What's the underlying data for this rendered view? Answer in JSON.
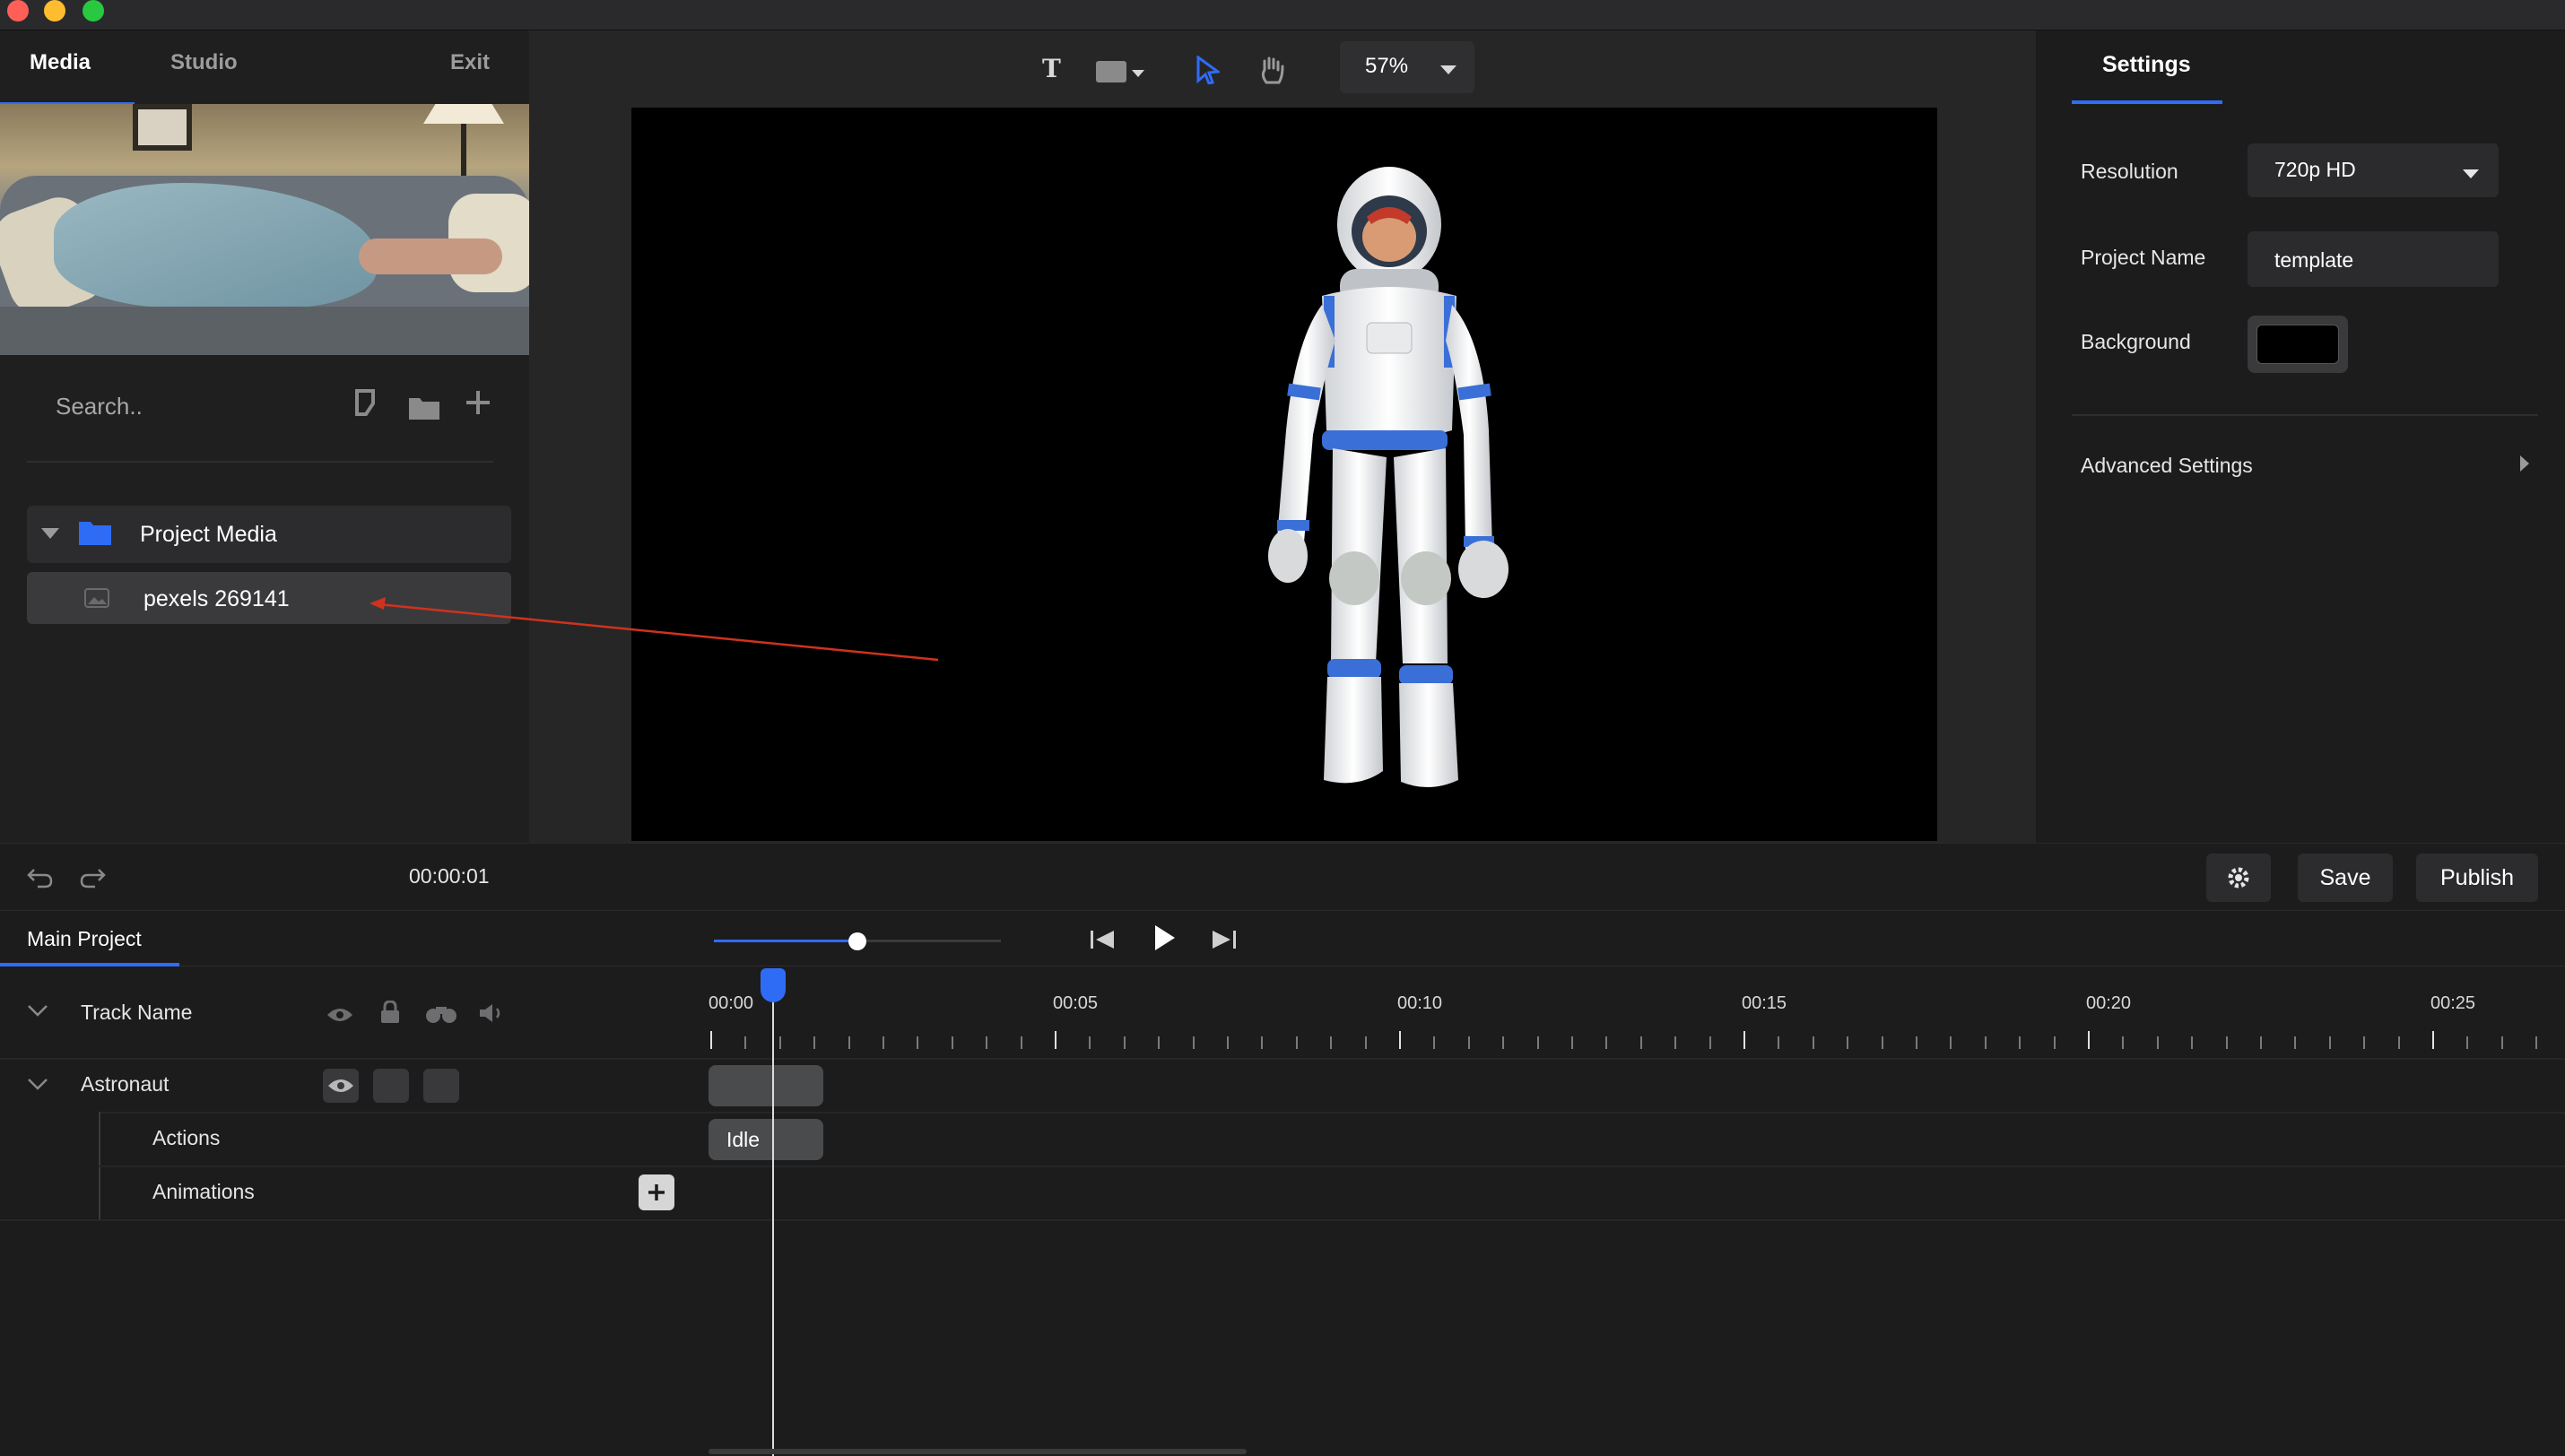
{
  "top_tabs": {
    "media": "Media",
    "studio": "Studio",
    "exit": "Exit"
  },
  "media_panel": {
    "search_placeholder": "Search..",
    "folder_name": "Project Media",
    "item_name": "pexels 269141"
  },
  "toolbar": {
    "zoom": "57%"
  },
  "settings": {
    "tab": "Settings",
    "resolution_label": "Resolution",
    "resolution_value": "720p HD",
    "project_name_label": "Project Name",
    "project_name_value": "template",
    "background_label": "Background",
    "background_color": "#000000",
    "advanced_label": "Advanced Settings"
  },
  "transport": {
    "time": "00:00:01",
    "save": "Save",
    "publish": "Publish"
  },
  "timeline": {
    "tab": "Main Project",
    "header_label": "Track Name",
    "ticks": [
      "00:00",
      "00:05",
      "00:10",
      "00:15",
      "00:20",
      "00:25"
    ],
    "tracks": {
      "name": "Astronaut",
      "actions_label": "Actions",
      "animations_label": "Animations",
      "action_clip": "Idle"
    }
  },
  "icons": {
    "text_tool": "text-tool-icon",
    "shape_tool": "shape-tool-icon",
    "select_tool": "cursor-icon",
    "pan_tool": "hand-icon"
  },
  "colors": {
    "accent": "#2f6cf6",
    "annotation_arrow": "#d0321e"
  }
}
